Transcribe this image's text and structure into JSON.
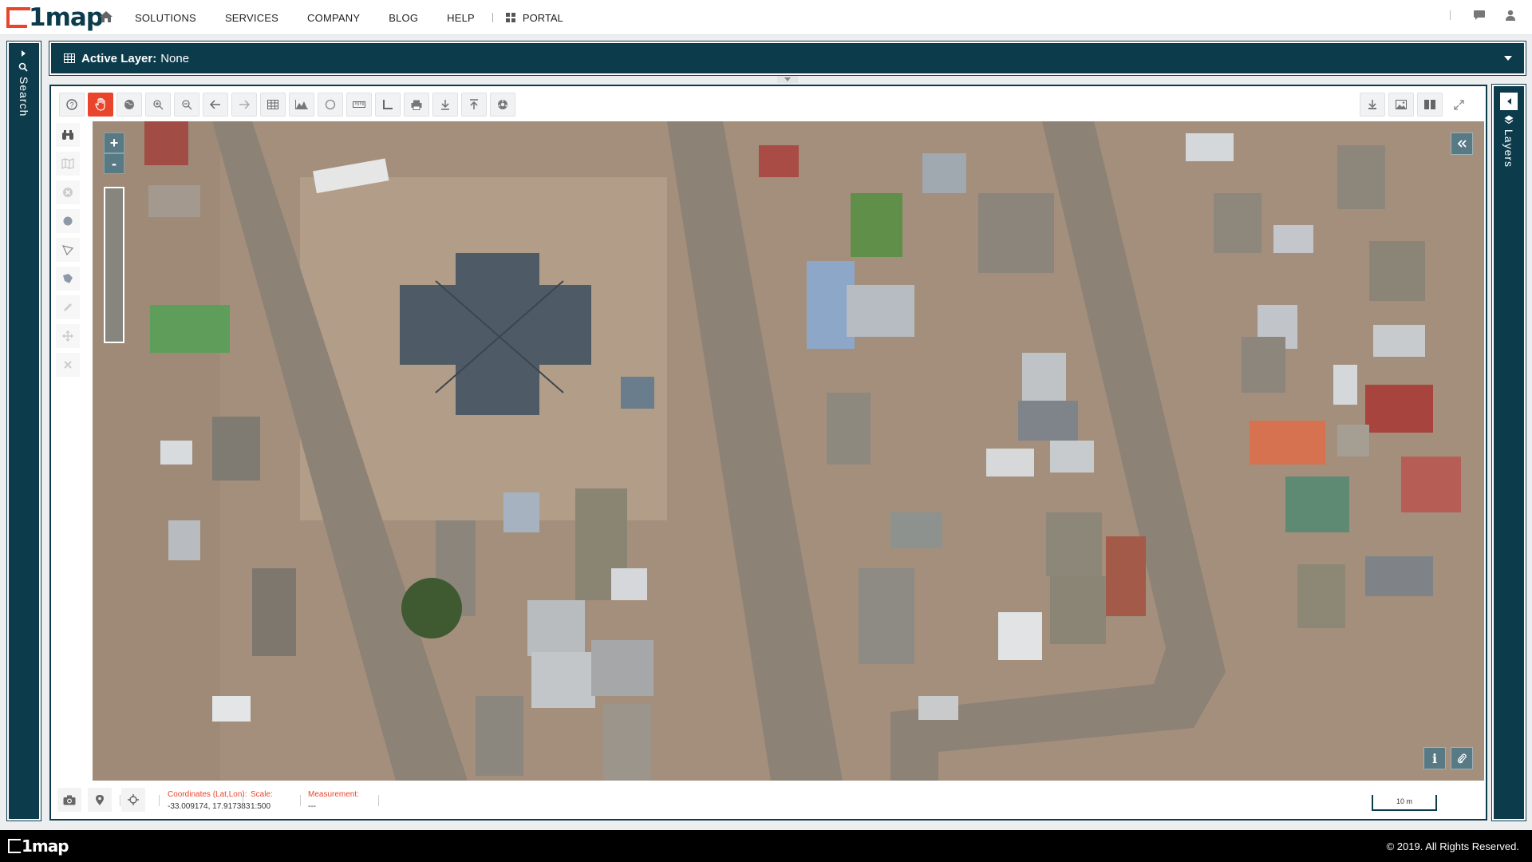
{
  "brand": {
    "logo_text": "1map",
    "accent": "#e8452c",
    "primary": "#0c3b4c"
  },
  "nav": {
    "items": [
      "SOLUTIONS",
      "SERVICES",
      "COMPANY",
      "BLOG",
      "HELP"
    ],
    "portal_label": "PORTAL"
  },
  "header_icons": [
    "home-icon",
    "chat-icon",
    "user-icon"
  ],
  "sidebars": {
    "left_label": "Search",
    "right_label": "Layers"
  },
  "layer_bar": {
    "label": "Active Layer:",
    "value": "None"
  },
  "toolbar_icons": [
    "help-icon",
    "pan-hand-icon",
    "globe-icon",
    "zoom-in-icon",
    "zoom-out-icon",
    "back-icon",
    "forward-icon",
    "table-icon",
    "chart-icon",
    "circle-icon",
    "ruler-icon",
    "angle-icon",
    "print-icon",
    "download-icon",
    "upload-icon",
    "settings-icon"
  ],
  "toolbar_right_icons": [
    "export-icon",
    "image-icon",
    "columns-icon",
    "fullscreen-icon"
  ],
  "left_tool_icons": [
    "binoculars-icon",
    "map-icon",
    "clear-icon",
    "circle-draw-icon",
    "polygon-icon",
    "polygon-fill-icon",
    "edit-icon",
    "move-icon",
    "delete-icon"
  ],
  "map": {
    "zoom_in_label": "+",
    "zoom_out_label": "-",
    "info_label": "i"
  },
  "readouts": {
    "coords_label": "Coordinates (Lat,Lon):",
    "coords_value": "-33.009174, 17.917383",
    "scale_label": "Scale:",
    "scale_value": "1:500",
    "measure_label": "Measurement:",
    "measure_value": "---",
    "scalebar_label": "10 m"
  },
  "footer": {
    "logo_text": "1map",
    "copyright": "© 2019. All Rights Reserved."
  }
}
